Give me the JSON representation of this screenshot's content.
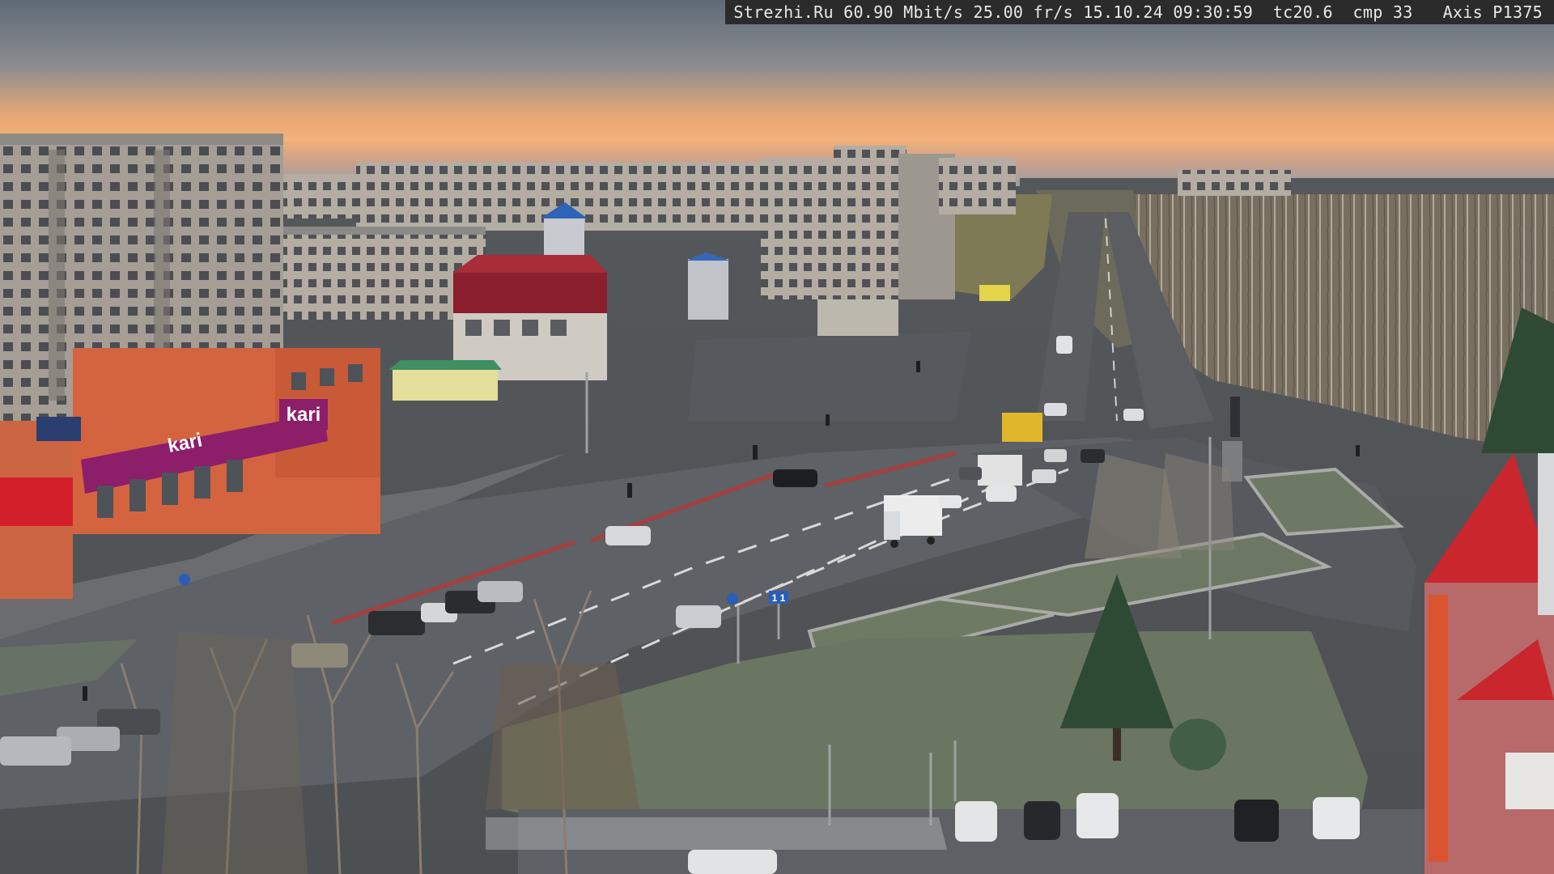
{
  "overlay": {
    "text": "Strezhi.Ru 60.90 Mbit/s 25.00 fr/s 15.10.24 09:30:59  tc20.6  cmp 33   Axis P1375"
  },
  "signs": {
    "store_logo": "kari",
    "store_banner": "kari",
    "road_sign_lanes": "1 1"
  },
  "colors": {
    "sky_top": "#6f7a86",
    "sky_glow": "#f0a870",
    "road": "#5f6266",
    "grass": "#6b7a5c",
    "building_grey": "#a8a29a",
    "store_orange": "#d8653e",
    "store_magenta": "#8a1f6a",
    "tower_red": "#c9262e"
  }
}
